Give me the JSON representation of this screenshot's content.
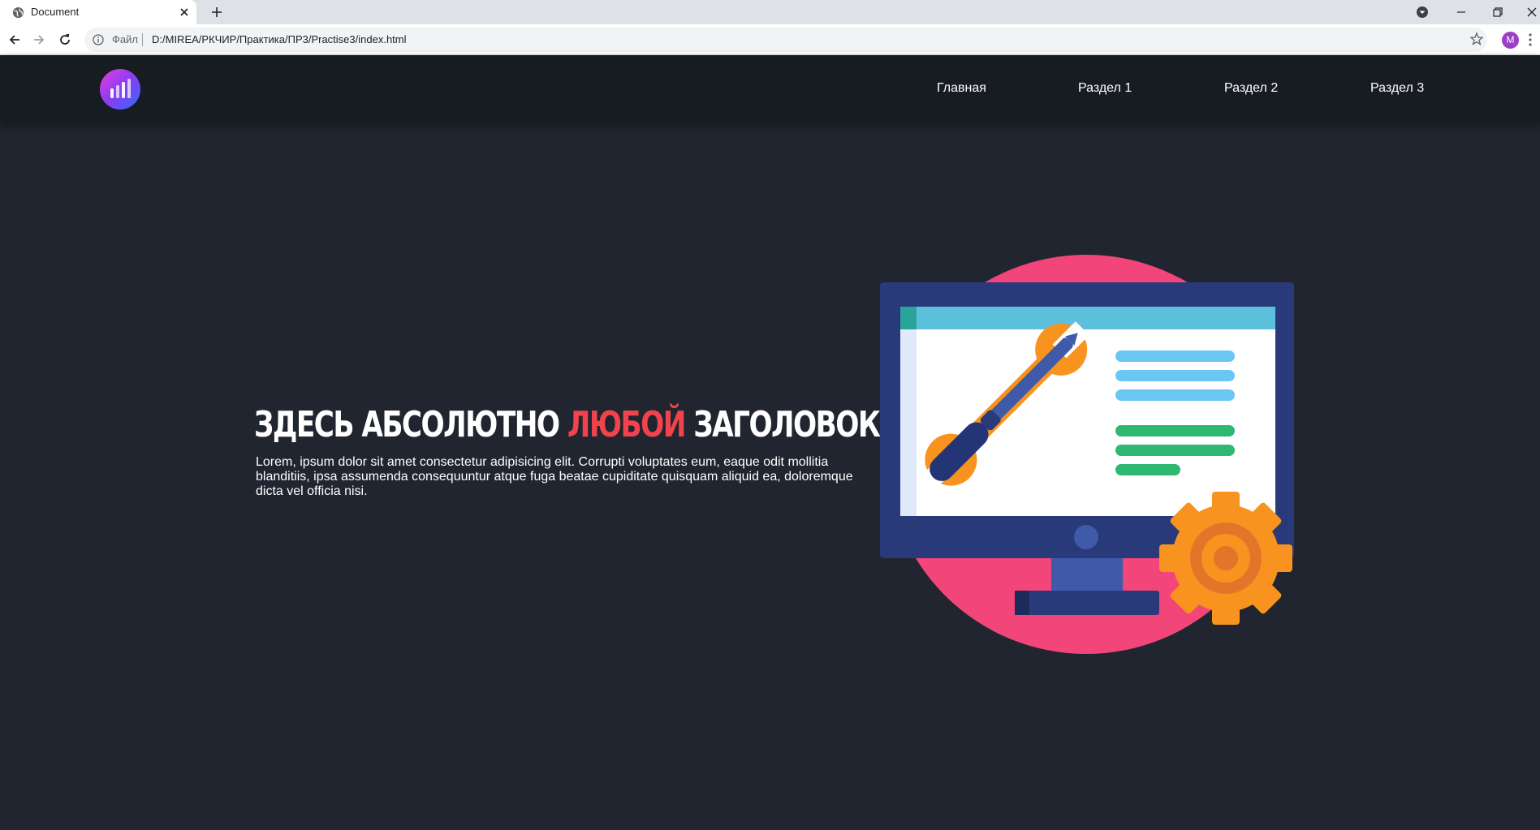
{
  "browser": {
    "tab": {
      "title": "Document"
    },
    "address": {
      "scheme_label": "Файл",
      "url": "D:/MIREA/РКЧИР/Практика/ПР3/Practise3/index.html"
    },
    "profile_initial": "M"
  },
  "header": {
    "nav": [
      "Главная",
      "Раздел 1",
      "Раздел 2",
      "Раздел 3"
    ]
  },
  "hero": {
    "title_before": "ЗДЕСЬ АБСОЛЮТНО ",
    "title_accent": "ЛЮБОЙ",
    "title_after": " ЗАГОЛОВОК",
    "text": "Lorem, ipsum dolor sit amet consectetur adipisicing elit. Corrupti voluptates eum, eaque odit mollitia blanditiis, ipsa assumenda consequuntur atque fuga beatae cupiditate quisquam aliquid ea, doloremque dicta vel officia nisi."
  },
  "colors": {
    "page_bg": "#20252f",
    "header_bg": "#171b22",
    "accent": "#f0434d"
  },
  "icons": {
    "logo": "bar-chart-logo",
    "illustration": "monitor-tools-gear"
  }
}
